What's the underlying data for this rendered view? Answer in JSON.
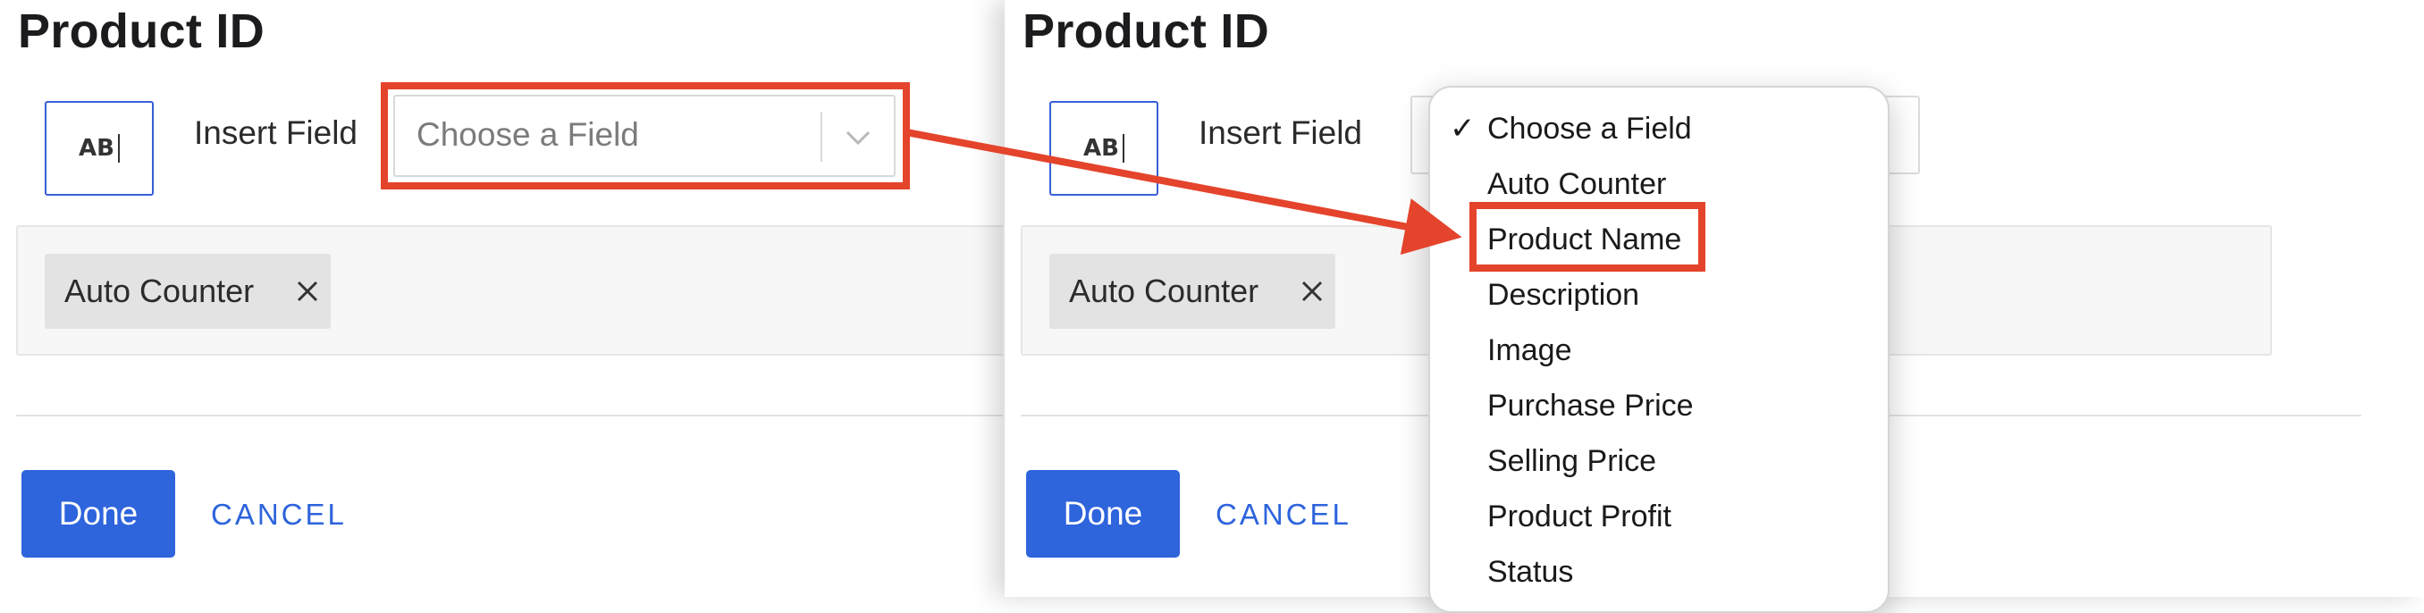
{
  "left_panel": {
    "title": "Product ID",
    "ab_icon_text": "AB",
    "insert_label": "Insert Field",
    "select_placeholder": "Choose a Field",
    "tag_label": "Auto Counter",
    "done_label": "Done",
    "cancel_label": "CANCEL"
  },
  "right_panel": {
    "title": "Product ID",
    "ab_icon_text": "AB",
    "insert_label": "Insert Field",
    "tag_label": "Auto Counter",
    "done_label": "Done",
    "cancel_label": "CANCEL"
  },
  "dropdown": {
    "selected_check": "✓",
    "items": [
      {
        "label": "Choose a Field",
        "selected": true
      },
      {
        "label": "Auto Counter"
      },
      {
        "label": "Product Name",
        "highlighted": true
      },
      {
        "label": "Description"
      },
      {
        "label": "Image"
      },
      {
        "label": "Purchase Price"
      },
      {
        "label": "Selling Price"
      },
      {
        "label": "Product Profit"
      },
      {
        "label": "Status"
      }
    ]
  },
  "colors": {
    "accent": "#2e64dc",
    "annotation": "#e4442b"
  },
  "icons": {
    "chevron": "chevron-down-icon",
    "tag_remove": "close-icon",
    "text_field": "text-field-icon",
    "checkmark": "checkmark-icon",
    "arrow": "arrow-right-icon"
  }
}
